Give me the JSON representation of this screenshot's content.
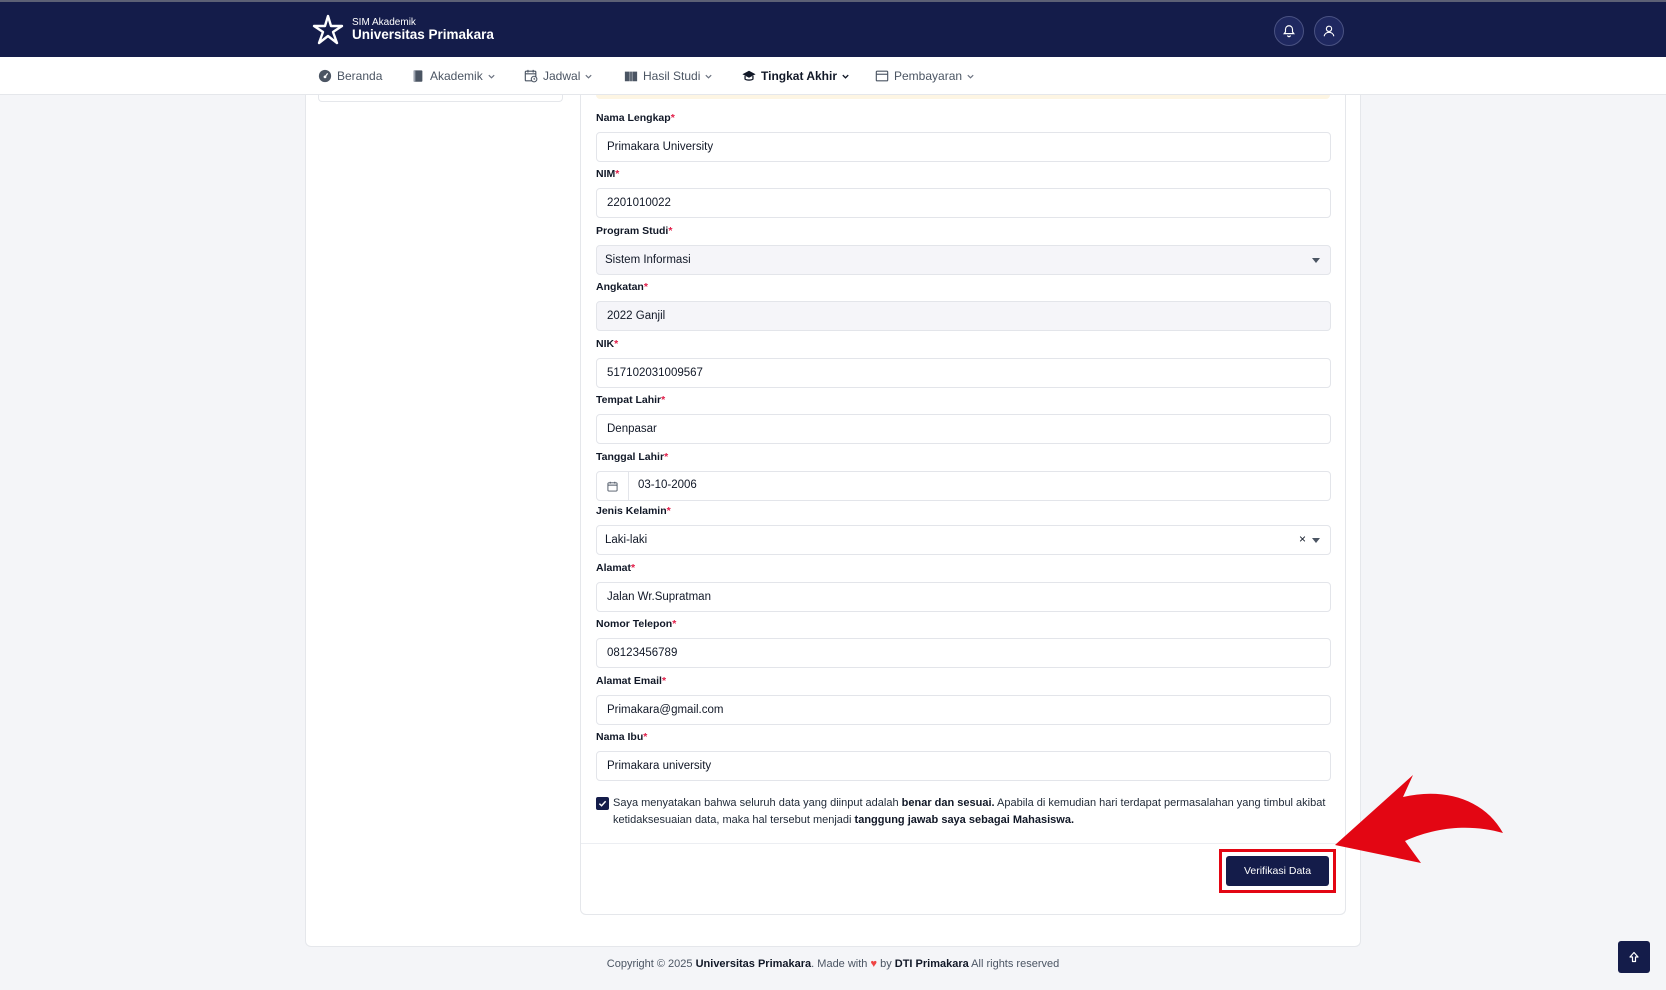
{
  "brand": {
    "subtitle": "SIM Akademik",
    "name": "Universitas Primakara"
  },
  "nav": [
    {
      "label": "Beranda",
      "icon": "dashboard-icon"
    },
    {
      "label": "Akademik",
      "icon": "book-icon"
    },
    {
      "label": "Jadwal",
      "icon": "calendar-clock-icon"
    },
    {
      "label": "Hasil Studi",
      "icon": "open-book-icon"
    },
    {
      "label": "Tingkat Akhir",
      "icon": "graduation-cap-icon",
      "active": true
    },
    {
      "label": "Pembayaran",
      "icon": "payment-card-icon"
    }
  ],
  "form": {
    "required_mark": "*",
    "nama_lengkap": {
      "label": "Nama Lengkap",
      "value": "Primakara University"
    },
    "nim": {
      "label": "NIM",
      "value": "2201010022"
    },
    "program_studi": {
      "label": "Program Studi",
      "value": "Sistem Informasi"
    },
    "angkatan": {
      "label": "Angkatan",
      "value": "2022 Ganjil"
    },
    "nik": {
      "label": "NIK",
      "value": "517102031009567"
    },
    "tempat_lahir": {
      "label": "Tempat Lahir",
      "value": "Denpasar"
    },
    "tanggal_lahir": {
      "label": "Tanggal Lahir",
      "value": "03-10-2006"
    },
    "jenis_kelamin": {
      "label": "Jenis Kelamin",
      "value": "Laki-laki",
      "clear": "×"
    },
    "alamat": {
      "label": "Alamat",
      "value": "Jalan Wr.Supratman"
    },
    "nomor_telepon": {
      "label": "Nomor Telepon",
      "value": "08123456789"
    },
    "alamat_email": {
      "label": "Alamat Email",
      "value": "Primakara@gmail.com"
    },
    "nama_ibu": {
      "label": "Nama Ibu",
      "value": "Primakara university"
    }
  },
  "declaration": {
    "checked": true,
    "part1": "Saya menyatakan bahwa seluruh data yang diinput adalah ",
    "bold1": "benar dan sesuai.",
    "part2": " Apabila di kemudian hari terdapat permasalahan yang timbul akibat ketidaksesuaian data, maka hal tersebut menjadi ",
    "bold2": "tanggung jawab saya sebagai Mahasiswa."
  },
  "verify_button": "Verifikasi Data",
  "footer": {
    "prefix": "Copyright © 2025 ",
    "org": "Universitas Primakara",
    "made": ". Made with ",
    "heart": "♥",
    "by": " by ",
    "team": "DTI Primakara",
    "suffix": " All rights reserved"
  },
  "colors": {
    "primary": "#141c4a",
    "highlight": "#e30613",
    "required": "#e11d48"
  }
}
